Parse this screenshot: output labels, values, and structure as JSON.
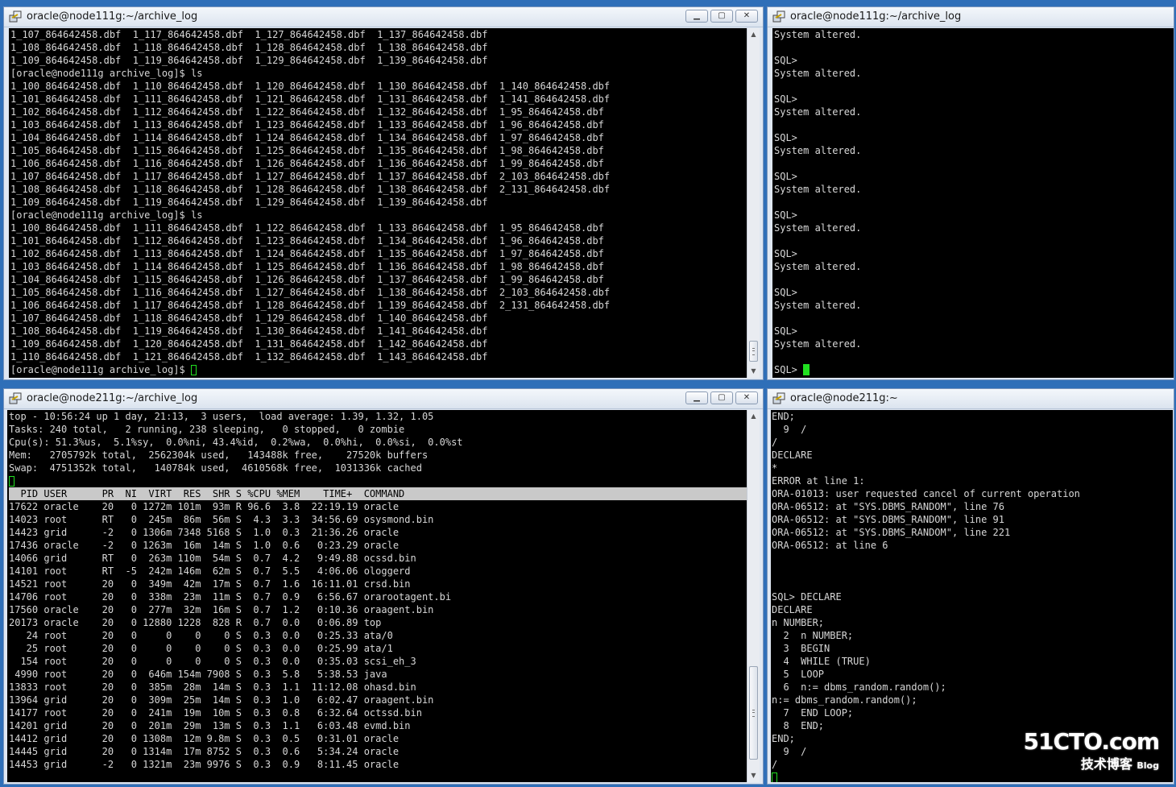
{
  "windows": {
    "top_left": {
      "title": "oracle@node111g:~/archive_log",
      "lines": [
        "1_107_864642458.dbf  1_117_864642458.dbf  1_127_864642458.dbf  1_137_864642458.dbf",
        "1_108_864642458.dbf  1_118_864642458.dbf  1_128_864642458.dbf  1_138_864642458.dbf",
        "1_109_864642458.dbf  1_119_864642458.dbf  1_129_864642458.dbf  1_139_864642458.dbf",
        "[oracle@node111g archive_log]$ ls",
        "1_100_864642458.dbf  1_110_864642458.dbf  1_120_864642458.dbf  1_130_864642458.dbf  1_140_864642458.dbf",
        "1_101_864642458.dbf  1_111_864642458.dbf  1_121_864642458.dbf  1_131_864642458.dbf  1_141_864642458.dbf",
        "1_102_864642458.dbf  1_112_864642458.dbf  1_122_864642458.dbf  1_132_864642458.dbf  1_95_864642458.dbf",
        "1_103_864642458.dbf  1_113_864642458.dbf  1_123_864642458.dbf  1_133_864642458.dbf  1_96_864642458.dbf",
        "1_104_864642458.dbf  1_114_864642458.dbf  1_124_864642458.dbf  1_134_864642458.dbf  1_97_864642458.dbf",
        "1_105_864642458.dbf  1_115_864642458.dbf  1_125_864642458.dbf  1_135_864642458.dbf  1_98_864642458.dbf",
        "1_106_864642458.dbf  1_116_864642458.dbf  1_126_864642458.dbf  1_136_864642458.dbf  1_99_864642458.dbf",
        "1_107_864642458.dbf  1_117_864642458.dbf  1_127_864642458.dbf  1_137_864642458.dbf  2_103_864642458.dbf",
        "1_108_864642458.dbf  1_118_864642458.dbf  1_128_864642458.dbf  1_138_864642458.dbf  2_131_864642458.dbf",
        "1_109_864642458.dbf  1_119_864642458.dbf  1_129_864642458.dbf  1_139_864642458.dbf",
        "[oracle@node111g archive_log]$ ls",
        "1_100_864642458.dbf  1_111_864642458.dbf  1_122_864642458.dbf  1_133_864642458.dbf  1_95_864642458.dbf",
        "1_101_864642458.dbf  1_112_864642458.dbf  1_123_864642458.dbf  1_134_864642458.dbf  1_96_864642458.dbf",
        "1_102_864642458.dbf  1_113_864642458.dbf  1_124_864642458.dbf  1_135_864642458.dbf  1_97_864642458.dbf",
        "1_103_864642458.dbf  1_114_864642458.dbf  1_125_864642458.dbf  1_136_864642458.dbf  1_98_864642458.dbf",
        "1_104_864642458.dbf  1_115_864642458.dbf  1_126_864642458.dbf  1_137_864642458.dbf  1_99_864642458.dbf",
        "1_105_864642458.dbf  1_116_864642458.dbf  1_127_864642458.dbf  1_138_864642458.dbf  2_103_864642458.dbf",
        "1_106_864642458.dbf  1_117_864642458.dbf  1_128_864642458.dbf  1_139_864642458.dbf  2_131_864642458.dbf",
        "1_107_864642458.dbf  1_118_864642458.dbf  1_129_864642458.dbf  1_140_864642458.dbf",
        "1_108_864642458.dbf  1_119_864642458.dbf  1_130_864642458.dbf  1_141_864642458.dbf",
        "1_109_864642458.dbf  1_120_864642458.dbf  1_131_864642458.dbf  1_142_864642458.dbf",
        "1_110_864642458.dbf  1_121_864642458.dbf  1_132_864642458.dbf  1_143_864642458.dbf"
      ],
      "prompt": "[oracle@node111g archive_log]$ "
    },
    "top_right": {
      "title": "oracle@node111g:~/archive_log",
      "lines": [
        "System altered.",
        "",
        "SQL>",
        "System altered.",
        "",
        "SQL>",
        "System altered.",
        "",
        "SQL>",
        "System altered.",
        "",
        "SQL>",
        "System altered.",
        "",
        "SQL>",
        "System altered.",
        "",
        "SQL>",
        "System altered.",
        "",
        "SQL>",
        "System altered.",
        "",
        "SQL>",
        "System altered.",
        ""
      ],
      "prompt": "SQL> "
    },
    "bottom_left": {
      "title": "oracle@node211g:~/archive_log",
      "summary": [
        "top - 10:56:24 up 1 day, 21:13,  3 users,  load average: 1.39, 1.32, 1.05",
        "Tasks: 240 total,   2 running, 238 sleeping,   0 stopped,   0 zombie",
        "Cpu(s): 51.3%us,  5.1%sy,  0.0%ni, 43.4%id,  0.2%wa,  0.0%hi,  0.0%si,  0.0%st",
        "Mem:   2705792k total,  2562304k used,   143488k free,    27520k buffers",
        "Swap:  4751352k total,   140784k used,  4610568k free,  1031336k cached"
      ],
      "header": "  PID USER      PR  NI  VIRT  RES  SHR S %CPU %MEM    TIME+  COMMAND",
      "processes": [
        "17622 oracle    20   0 1272m 101m  93m R 96.6  3.8  22:19.19 oracle",
        "14023 root      RT   0  245m  86m  56m S  4.3  3.3  34:56.69 osysmond.bin",
        "14423 grid      -2   0 1306m 7348 5168 S  1.0  0.3  21:36.26 oracle",
        "17436 oracle    -2   0 1263m  16m  14m S  1.0  0.6   0:23.29 oracle",
        "14066 grid      RT   0  263m 110m  54m S  0.7  4.2   9:49.88 ocssd.bin",
        "14101 root      RT  -5  242m 146m  62m S  0.7  5.5   4:06.06 ologgerd",
        "14521 root      20   0  349m  42m  17m S  0.7  1.6  16:11.01 crsd.bin",
        "14706 root      20   0  338m  23m  11m S  0.7  0.9   6:56.67 orarootagent.bi",
        "17560 oracle    20   0  277m  32m  16m S  0.7  1.2   0:10.36 oraagent.bin",
        "20173 oracle    20   0 12880 1228  828 R  0.7  0.0   0:06.89 top",
        "   24 root      20   0     0    0    0 S  0.3  0.0   0:25.33 ata/0",
        "   25 root      20   0     0    0    0 S  0.3  0.0   0:25.99 ata/1",
        "  154 root      20   0     0    0    0 S  0.3  0.0   0:35.03 scsi_eh_3",
        " 4990 root      20   0  646m 154m 7908 S  0.3  5.8   5:38.53 java",
        "13833 root      20   0  385m  28m  14m S  0.3  1.1  11:12.08 ohasd.bin",
        "13964 grid      20   0  309m  25m  14m S  0.3  1.0   6:02.47 oraagent.bin",
        "14177 root      20   0  241m  19m  10m S  0.3  0.8   6:32.64 octssd.bin",
        "14201 grid      20   0  201m  29m  13m S  0.3  1.1   6:03.48 evmd.bin",
        "14412 grid      20   0 1308m  12m 9.8m S  0.3  0.5   0:31.01 oracle",
        "14445 grid      20   0 1314m  17m 8752 S  0.3  0.6   5:34.24 oracle",
        "14453 grid      -2   0 1321m  23m 9976 S  0.3  0.9   8:11.45 oracle"
      ]
    },
    "bottom_right": {
      "title": "oracle@node211g:~",
      "lines": [
        "END;",
        "  9  /",
        "/",
        "DECLARE",
        "*",
        "ERROR at line 1:",
        "ORA-01013: user requested cancel of current operation",
        "ORA-06512: at \"SYS.DBMS_RANDOM\", line 76",
        "ORA-06512: at \"SYS.DBMS_RANDOM\", line 91",
        "ORA-06512: at \"SYS.DBMS_RANDOM\", line 221",
        "ORA-06512: at line 6",
        "",
        "",
        "",
        "SQL> DECLARE",
        "DECLARE",
        "n NUMBER;",
        "  2  n NUMBER;",
        "  3  BEGIN",
        "  4  WHILE (TRUE)",
        "  5  LOOP",
        "  6  n:= dbms_random.random();",
        "n:= dbms_random.random();",
        "  7  END LOOP;",
        "  8  END;",
        "END;",
        "  9  /",
        "/"
      ]
    }
  },
  "watermark": {
    "brand": "51CTO.com",
    "sub": "技术博客",
    "blog": "Blog"
  },
  "colors": {
    "terminal_bg": "#000000",
    "terminal_fg": "#d7d7d7",
    "cursor": "#21e021",
    "desktop": "#2f6fb8"
  }
}
